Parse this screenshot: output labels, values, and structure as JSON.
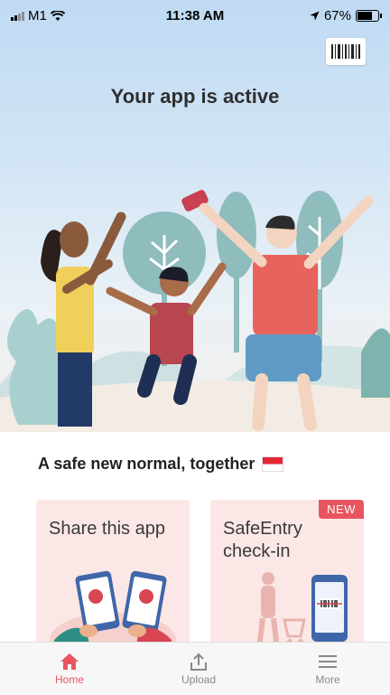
{
  "status_bar": {
    "carrier": "M1",
    "time": "11:38 AM",
    "battery": "67%"
  },
  "hero": {
    "title": "Your app is active",
    "barcode_icon": "barcode-icon"
  },
  "tagline": {
    "text": "A safe new normal, together",
    "flag_icon": "singapore-flag-icon"
  },
  "cards": [
    {
      "title": "Share this app",
      "badge": ""
    },
    {
      "title": "SafeEntry check-in",
      "badge": "NEW"
    }
  ],
  "tabs": [
    {
      "label": "Home",
      "icon": "home-icon",
      "active": true
    },
    {
      "label": "Upload",
      "icon": "upload-icon",
      "active": false
    },
    {
      "label": "More",
      "icon": "menu-icon",
      "active": false
    }
  ],
  "colors": {
    "accent": "#e8555f",
    "card_bg": "#fbe7e6",
    "sky": "#bfdaf3"
  }
}
